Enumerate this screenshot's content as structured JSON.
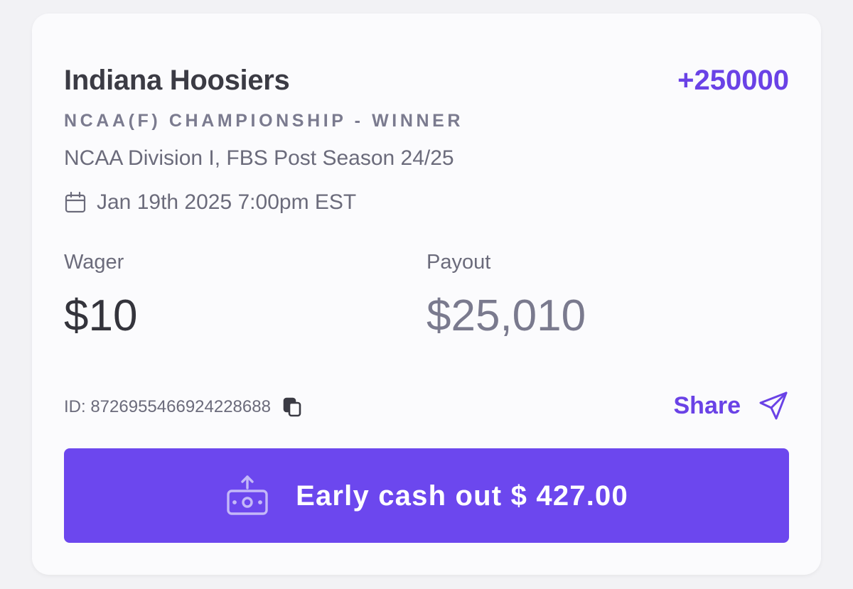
{
  "bet": {
    "team": "Indiana Hoosiers",
    "odds": "+250000",
    "market": "NCAA(F) CHAMPIONSHIP - WINNER",
    "event": "NCAA Division I, FBS Post Season 24/25",
    "date": "Jan 19th 2025 7:00pm EST"
  },
  "amounts": {
    "wager_label": "Wager",
    "wager_value": "$10",
    "payout_label": "Payout",
    "payout_value": "$25,010"
  },
  "footer": {
    "id_text": "ID: 8726955466924228688",
    "share_label": "Share"
  },
  "cashout": {
    "label": "Early cash out $ 427.00"
  },
  "icons": {
    "calendar": "calendar-icon",
    "copy": "copy-icon",
    "share": "send-icon",
    "cashout": "cash-upload-icon"
  },
  "colors": {
    "accent": "#6a42e6",
    "button_bg": "#6c47ee",
    "text_primary": "#3b3b44",
    "text_secondary": "#6b6b7b",
    "card_bg": "#fbfbfd",
    "page_bg": "#f2f2f5"
  }
}
